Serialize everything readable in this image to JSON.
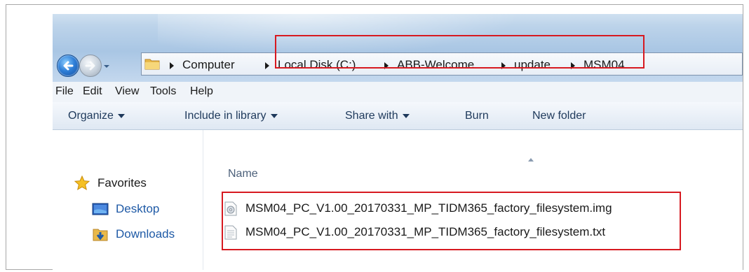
{
  "breadcrumb": [
    {
      "label": "Computer"
    },
    {
      "label": "Local Disk (C:)"
    },
    {
      "label": "ABB-Welcome"
    },
    {
      "label": "update"
    },
    {
      "label": "MSM04"
    }
  ],
  "menu": [
    "File",
    "Edit",
    "View",
    "Tools",
    "Help"
  ],
  "toolbar": {
    "organize": "Organize",
    "include_in_library": "Include in library",
    "share_with": "Share with",
    "burn": "Burn",
    "new_folder": "New folder"
  },
  "navpane": {
    "favorites": "Favorites",
    "desktop": "Desktop",
    "downloads": "Downloads"
  },
  "filelist": {
    "column_name": "Name",
    "files": [
      {
        "name": "MSM04_PC_V1.00_20170331_MP_TIDM365_factory_filesystem.img",
        "icon": "disk-image-icon"
      },
      {
        "name": "MSM04_PC_V1.00_20170331_MP_TIDM365_factory_filesystem.txt",
        "icon": "text-file-icon"
      }
    ]
  },
  "colors": {
    "highlight": "#d71920",
    "link_blue": "#1f5aa6",
    "text": "#1a1a1a"
  }
}
